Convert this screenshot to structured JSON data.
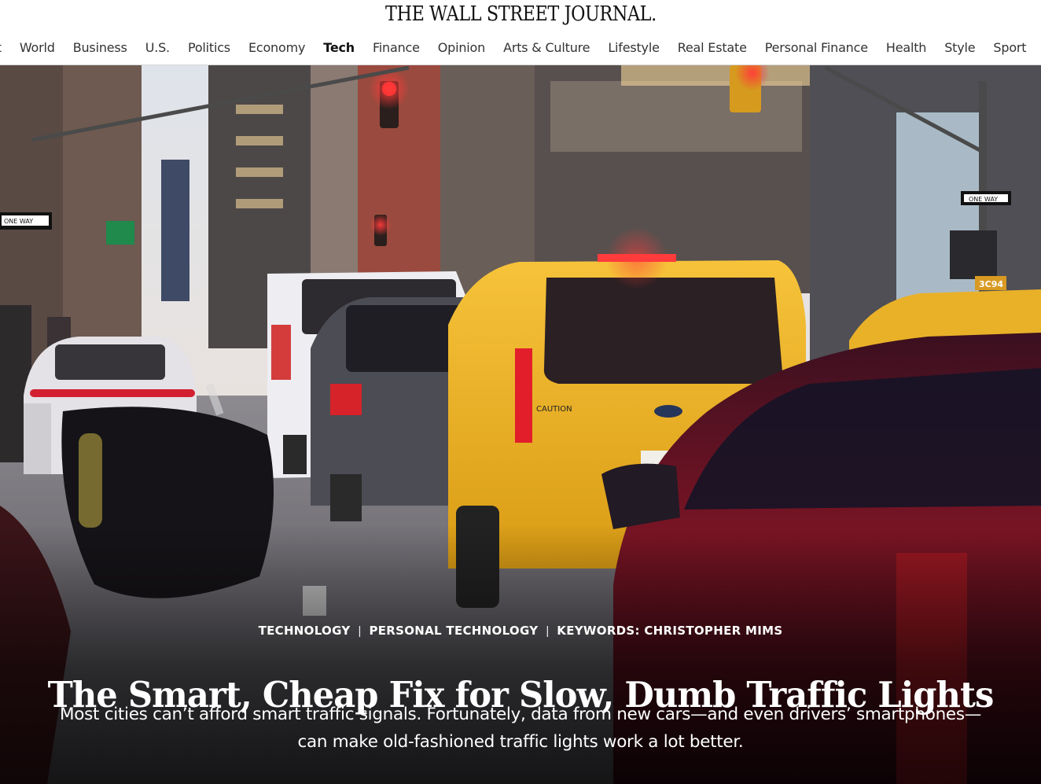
{
  "masthead": {
    "logo": "THE WALL STREET JOURNAL."
  },
  "nav": {
    "items": [
      {
        "label": "est"
      },
      {
        "label": "World"
      },
      {
        "label": "Business"
      },
      {
        "label": "U.S."
      },
      {
        "label": "Politics"
      },
      {
        "label": "Economy"
      },
      {
        "label": "Tech"
      },
      {
        "label": "Finance"
      },
      {
        "label": "Opinion"
      },
      {
        "label": "Arts & Culture"
      },
      {
        "label": "Lifestyle"
      },
      {
        "label": "Real Estate"
      },
      {
        "label": "Personal Finance"
      },
      {
        "label": "Health"
      },
      {
        "label": "Style"
      },
      {
        "label": "Sport"
      }
    ],
    "active": "Tech"
  },
  "article": {
    "flashline": [
      "TECHNOLOGY",
      "PERSONAL TECHNOLOGY",
      "KEYWORDS: CHRISTOPHER MIMS"
    ],
    "headline": "The Smart, Cheap Fix for Slow, Dumb Traffic Lights",
    "dek_line1": "Most cities can’t afford smart traffic signals. Fortunately, data from new cars—and even drivers’ smartphones—",
    "dek_line2": "can make old-fashioned traffic lights work a lot better.",
    "hero_image": {
      "signs": [
        "ONE WAY",
        "ONE WAY",
        "3C94",
        "CAUTION"
      ]
    }
  },
  "colors": {
    "taxi_yellow": "#f2b41e",
    "brake_red": "#e21e2a",
    "link": "#111111"
  }
}
